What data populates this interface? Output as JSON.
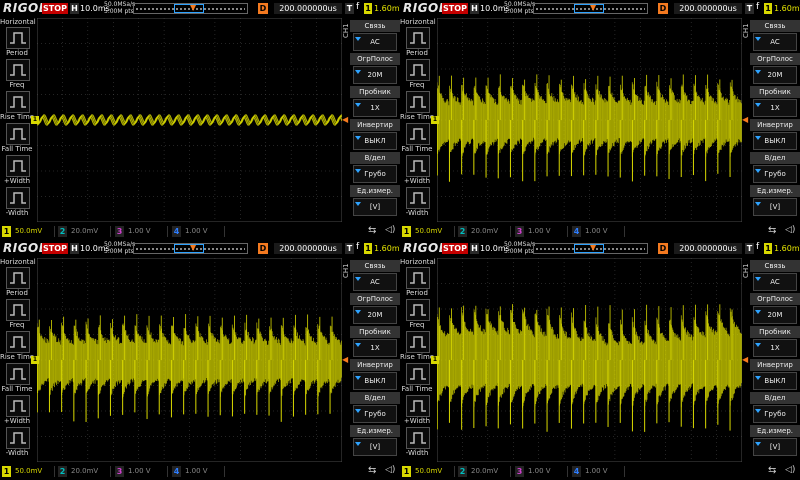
{
  "colors": {
    "ch1": "#d8d800",
    "ch2": "#00bfbf",
    "ch3": "#d040d0",
    "ch4": "#2e7dff",
    "trigger": "#f47a20",
    "stop": "#c40000",
    "grid": "#4a4a4a"
  },
  "common": {
    "logo": "RIGOL",
    "stop": "STOP",
    "h_label": "H",
    "timebase": "10.0ms",
    "sample_rate": "50.0MSa/s",
    "memory_depth": "5.00M pts",
    "trigger_pos_icon": "orange-t-arrow",
    "d_label": "D",
    "delay": "200.000000us",
    "t_label": "T",
    "trigger_edge": "f",
    "trigger_level": "1.60mV",
    "left_menu": {
      "title": "Horizontal",
      "items": [
        {
          "label": "Period",
          "icon": "period-icon"
        },
        {
          "label": "Freq",
          "icon": "freq-icon"
        },
        {
          "label": "Rise Time",
          "icon": "rise-time-icon"
        },
        {
          "label": "Fall Time",
          "icon": "fall-time-icon"
        },
        {
          "label": "+Width",
          "icon": "plus-width-icon"
        },
        {
          "label": "-Width",
          "icon": "minus-width-icon"
        }
      ]
    },
    "right_menu": {
      "channel": "CH1",
      "items": [
        {
          "label": "Связь",
          "value": "AC"
        },
        {
          "label": "ОгрПолос",
          "value": "20M"
        },
        {
          "label": "Пробник",
          "value": "1X"
        },
        {
          "label": "Инвертир",
          "value": "ВЫКЛ"
        },
        {
          "label": "В/дел",
          "value": "Грубо"
        },
        {
          "label": "Ед.измер.",
          "value": "[V]"
        }
      ]
    },
    "channels": [
      {
        "num": "1",
        "scale": "50.0mV"
      },
      {
        "num": "2",
        "scale": "20.0mV"
      },
      {
        "num": "3",
        "scale": "1.00 V"
      },
      {
        "num": "4",
        "scale": "1.00 V"
      }
    ]
  },
  "panels": [
    {
      "waveform": "low-amplitude-sine",
      "ch1_marker": "1",
      "offset_row": 5.0
    },
    {
      "waveform": "high-amplitude-ringing",
      "ch1_marker": "1",
      "offset_row": 5.0
    },
    {
      "waveform": "high-amplitude-ringing",
      "ch1_marker": "1",
      "offset_row": 5.0
    },
    {
      "waveform": "high-amplitude-ringing-dense",
      "ch1_marker": "1",
      "offset_row": 5.0
    }
  ]
}
